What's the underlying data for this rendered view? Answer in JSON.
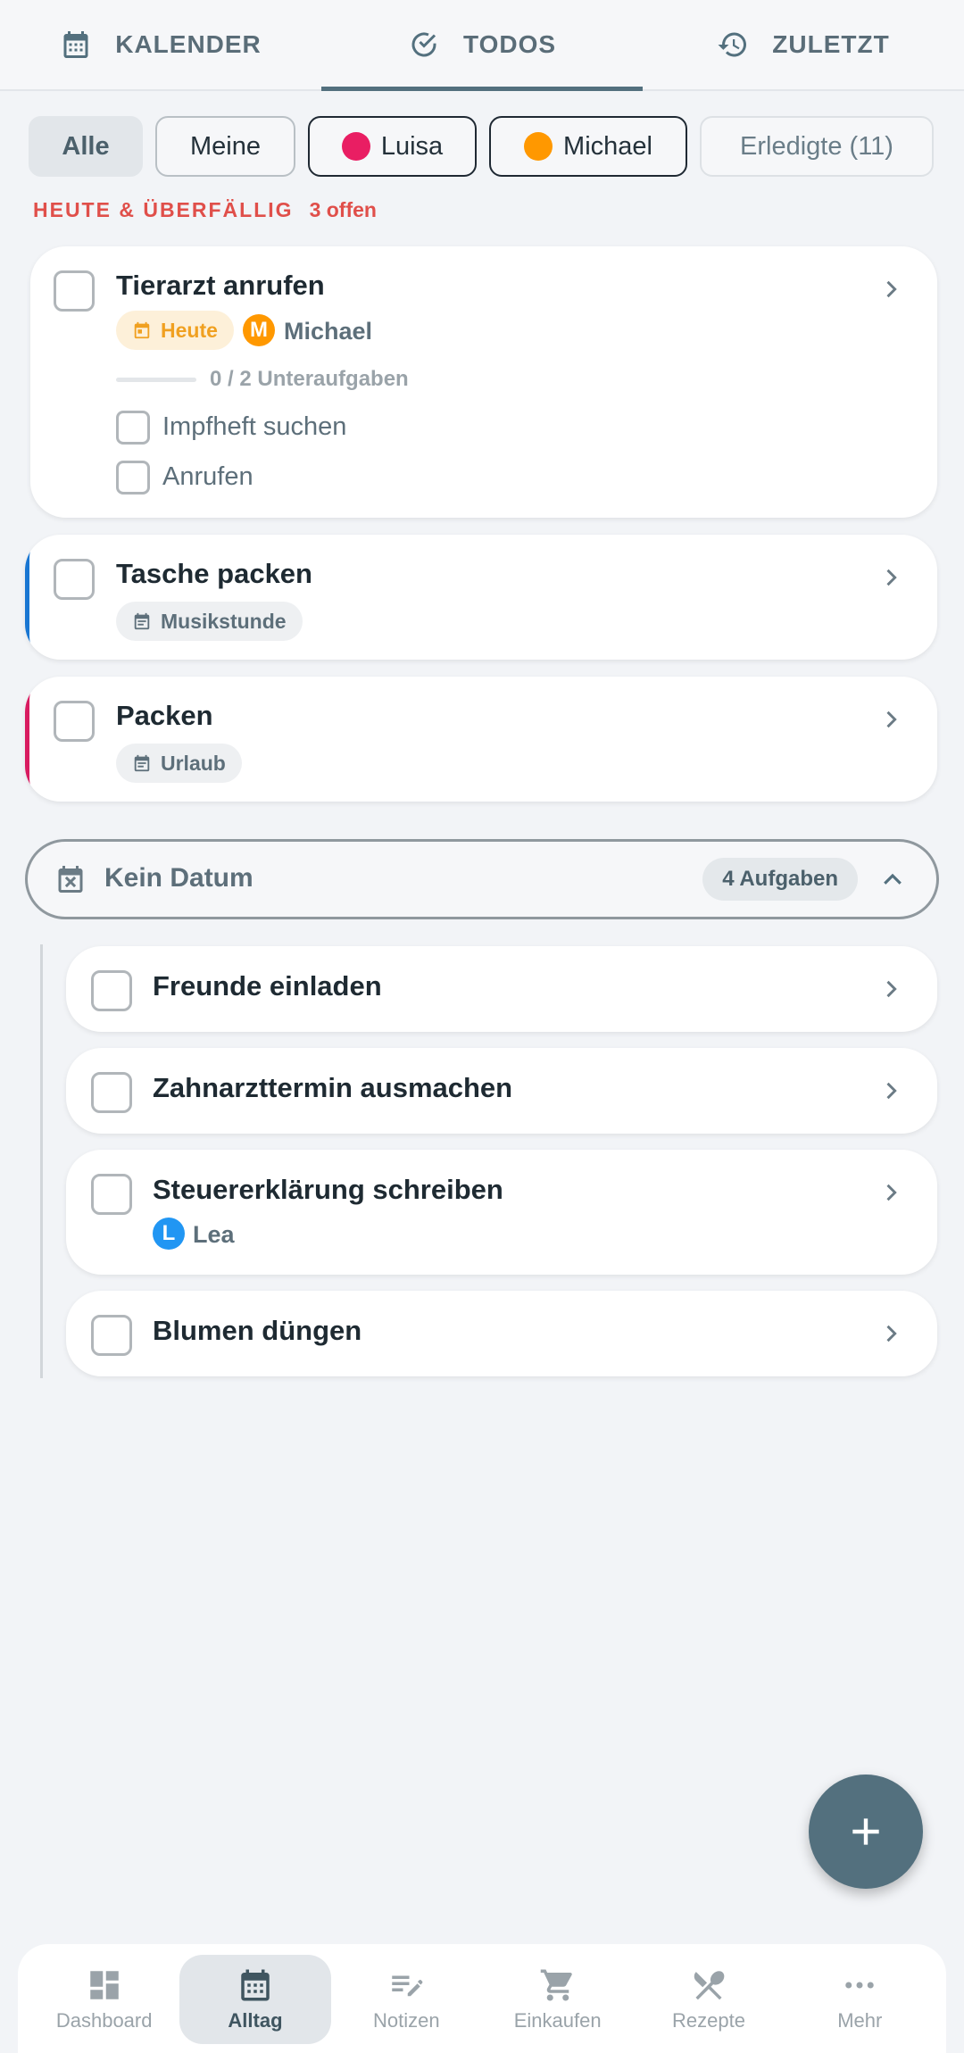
{
  "top_tabs": [
    {
      "label": "KALENDER",
      "icon": "calendar-icon"
    },
    {
      "label": "TODOS",
      "icon": "check-circle-icon"
    },
    {
      "label": "ZULETZT",
      "icon": "history-icon"
    }
  ],
  "filters": {
    "all": "Alle",
    "mine": "Meine",
    "luisa": "Luisa",
    "michael": "Michael",
    "done": "Erledigte (11)"
  },
  "colors": {
    "luisa": "#e91e63",
    "michael": "#ff9800",
    "lea": "#2196f3",
    "accent_blue": "#1976d2",
    "accent_red": "#d81b60",
    "primary": "#53707e"
  },
  "section_today": {
    "title": "HEUTE & ÜBERFÄLLIG",
    "count": "3 offen"
  },
  "tasks_today": [
    {
      "title": "Tierarzt anrufen",
      "due": "Heute",
      "assignee_initial": "M",
      "assignee": "Michael",
      "subtasks_progress": "0 / 2 Unteraufgaben",
      "subtasks": [
        "Impfheft suchen",
        "Anrufen"
      ]
    },
    {
      "title": "Tasche packen",
      "event": "Musikstunde"
    },
    {
      "title": "Packen",
      "event": "Urlaub"
    }
  ],
  "group_no_date": {
    "title": "Kein Datum",
    "count": "4 Aufgaben",
    "tasks": [
      {
        "title": "Freunde einladen"
      },
      {
        "title": "Zahnarzttermin ausmachen"
      },
      {
        "title": "Steuererklärung schreiben",
        "assignee_initial": "L",
        "assignee": "Lea"
      },
      {
        "title": "Blumen düngen"
      }
    ]
  },
  "bottom_nav": [
    {
      "label": "Dashboard",
      "icon": "dashboard-icon"
    },
    {
      "label": "Alltag",
      "icon": "calendar-icon"
    },
    {
      "label": "Notizen",
      "icon": "notes-icon"
    },
    {
      "label": "Einkaufen",
      "icon": "cart-icon"
    },
    {
      "label": "Rezepte",
      "icon": "utensils-icon"
    },
    {
      "label": "Mehr",
      "icon": "more-icon"
    }
  ]
}
